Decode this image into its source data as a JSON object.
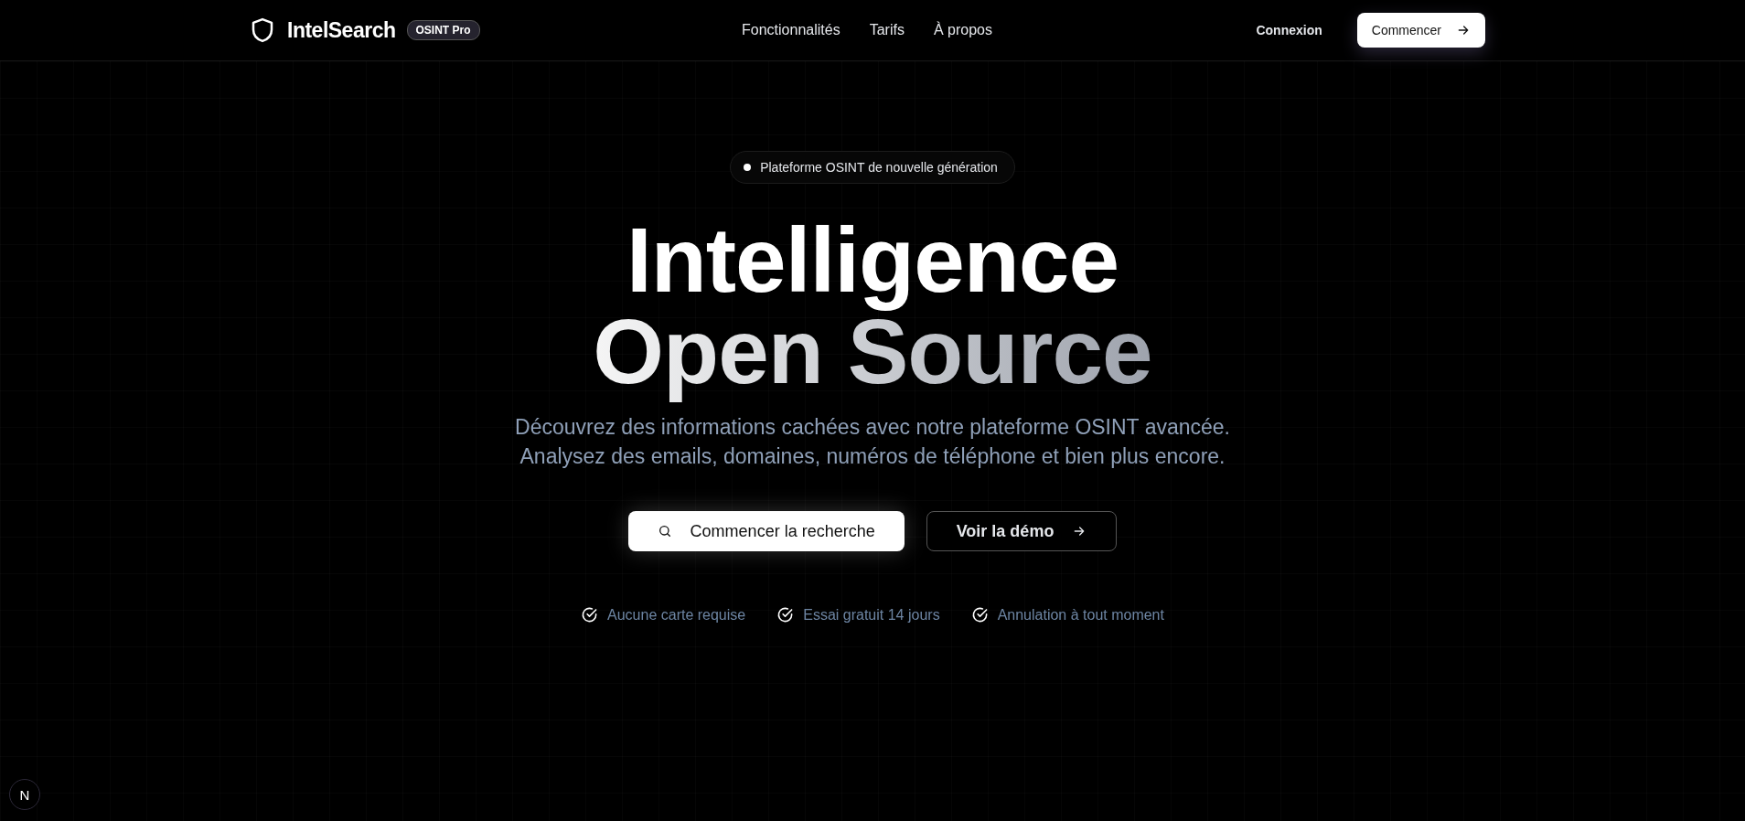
{
  "header": {
    "brand": "IntelSearch",
    "brand_badge": "OSINT Pro",
    "nav": [
      "Fonctionnalités",
      "Tarifs",
      "À propos"
    ],
    "login": "Connexion",
    "cta": "Commencer"
  },
  "hero": {
    "badge": "Plateforme OSINT de nouvelle génération",
    "title_lines": [
      "Intelligence",
      "Open Source"
    ],
    "subtitle": "Découvrez des informations cachées avec notre plateforme OSINT avancée. Analysez des emails, domaines, numéros de téléphone et bien plus encore.",
    "buttons": [
      {
        "kind": "primary",
        "label": "Commencer la recherche"
      },
      {
        "kind": "outline",
        "label": "Voir la démo"
      }
    ],
    "features": [
      "Aucune carte requise",
      "Essai gratuit 14 jours",
      "Annulation à tout moment"
    ]
  },
  "dev_indicator": {
    "label": "N"
  }
}
